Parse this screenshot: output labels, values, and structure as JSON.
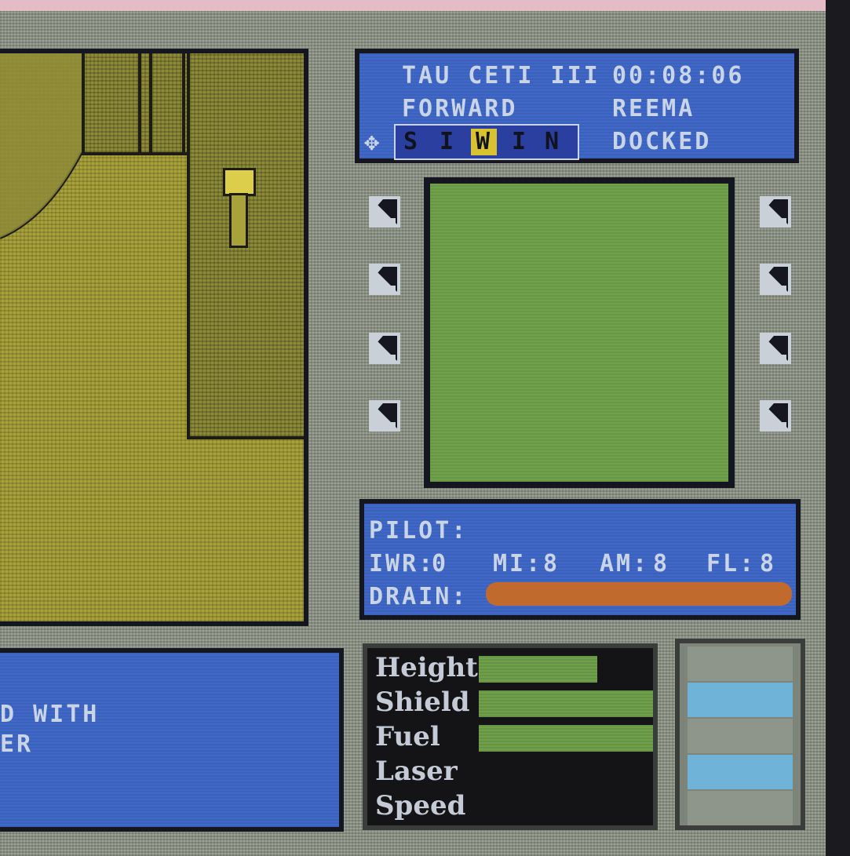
{
  "status": {
    "location": "TAU CETI III",
    "clock": "00:08:06",
    "view_direction": "FORWARD",
    "zone": "REEMA",
    "mode_arrow": "✥",
    "mode_letters": [
      "S",
      "I",
      "W",
      "I",
      "N"
    ],
    "dock_state": "DOCKED"
  },
  "pilot": {
    "title": "PILOT:",
    "stats": [
      {
        "label": "IWR:",
        "value": "0"
      },
      {
        "label": "MI:",
        "value": "8"
      },
      {
        "label": "AM:",
        "value": "8"
      },
      {
        "label": "FL:",
        "value": "8"
      }
    ],
    "drain_label": "DRAIN:",
    "drain_level": 1.0
  },
  "message": {
    "line1": "D WITH",
    "line2": "ER"
  },
  "gauges": [
    {
      "label": "Height",
      "level": 0.68
    },
    {
      "label": "Shield",
      "level": 1.0
    },
    {
      "label": "Fuel",
      "level": 1.0
    },
    {
      "label": "Laser",
      "level": 0.0
    },
    {
      "label": "Speed",
      "level": 0.0
    }
  ],
  "indicator_lights": [
    "off",
    "on",
    "off",
    "on",
    "off"
  ],
  "colors": {
    "panel_blue": "#3f68c8",
    "gauge_green": "#6ea14a",
    "drain_orange": "#c06a2e",
    "light_on": "#6fb4d8",
    "light_off": "#8e968b",
    "view_yellow": "#a9a23a",
    "mode_highlight": "#d8c231"
  }
}
